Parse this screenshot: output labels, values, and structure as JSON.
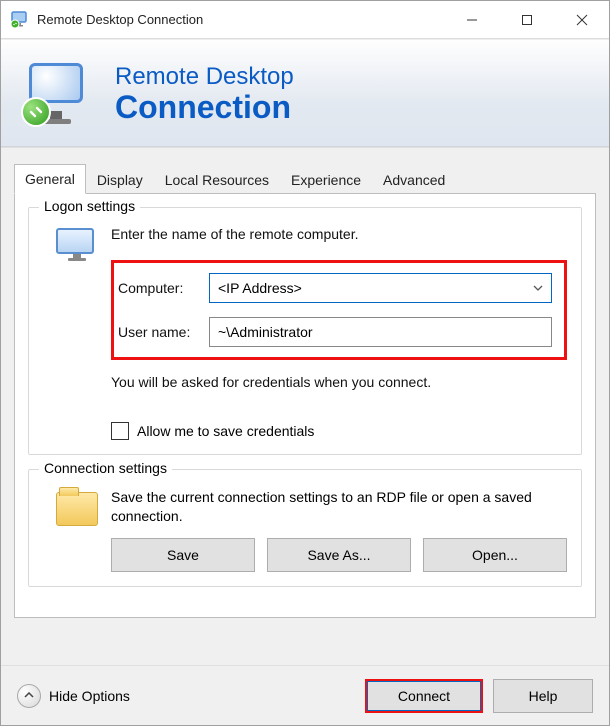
{
  "window": {
    "title": "Remote Desktop Connection"
  },
  "banner": {
    "line1": "Remote Desktop",
    "line2": "Connection"
  },
  "tabs": {
    "general": "General",
    "display": "Display",
    "local": "Local Resources",
    "experience": "Experience",
    "advanced": "Advanced"
  },
  "logon": {
    "group_title": "Logon settings",
    "instruction": "Enter the name of the remote computer.",
    "computer_label": "Computer:",
    "computer_value": "<IP Address>",
    "username_label": "User name:",
    "username_value": "~\\Administrator",
    "note": "You will be asked for credentials when you connect.",
    "allow_save_label": "Allow me to save credentials"
  },
  "connection": {
    "group_title": "Connection settings",
    "text": "Save the current connection settings to an RDP file or open a saved connection.",
    "save": "Save",
    "save_as": "Save As...",
    "open": "Open..."
  },
  "bottom": {
    "hide_options": "Hide Options",
    "connect": "Connect",
    "help": "Help"
  }
}
